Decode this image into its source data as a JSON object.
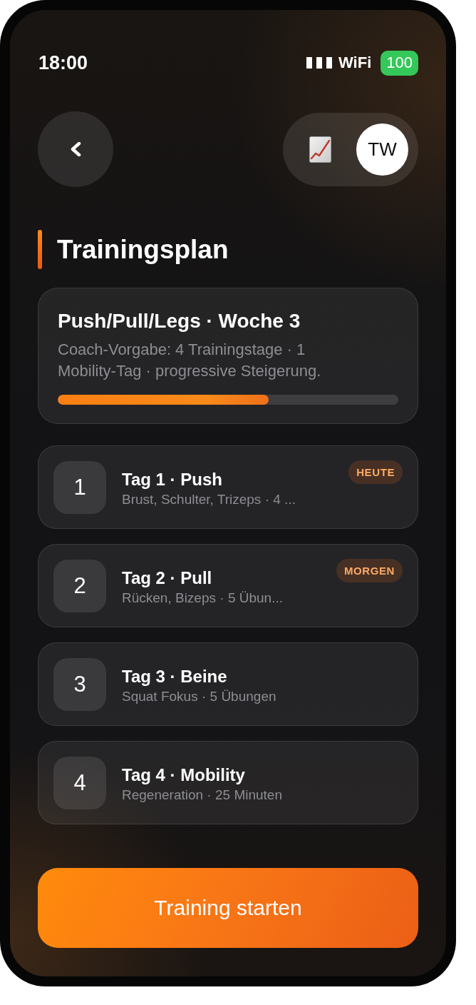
{
  "status_bar": {
    "time": "18:00",
    "network": "WiFi",
    "battery": "100"
  },
  "header": {
    "avatar": "TW"
  },
  "section": {
    "title": "Trainingsplan"
  },
  "plan": {
    "title": "Push/Pull/Legs · Woche 3",
    "description": "Coach-Vorgabe: 4 Trainingstage · 1 Mobility-Tag · progressive Steigerung.",
    "level": 0.62
  },
  "days": [
    {
      "number": "1",
      "title": "Tag 1 · Push",
      "subtitle": "Brust, Schulter, Trizeps · 4 ...",
      "badge": "HEUTE"
    },
    {
      "number": "2",
      "title": "Tag 2 · Pull",
      "subtitle": "Rücken, Bizeps · 5 Übun...",
      "badge": "MORGEN"
    },
    {
      "number": "3",
      "title": "Tag 3 · Beine",
      "subtitle": "Squat Fokus · 5 Übungen"
    },
    {
      "number": "4",
      "title": "Tag 4 · Mobility",
      "subtitle": "Regeneration · 25 Minuten"
    }
  ],
  "start_button": {
    "label": "Training starten"
  }
}
